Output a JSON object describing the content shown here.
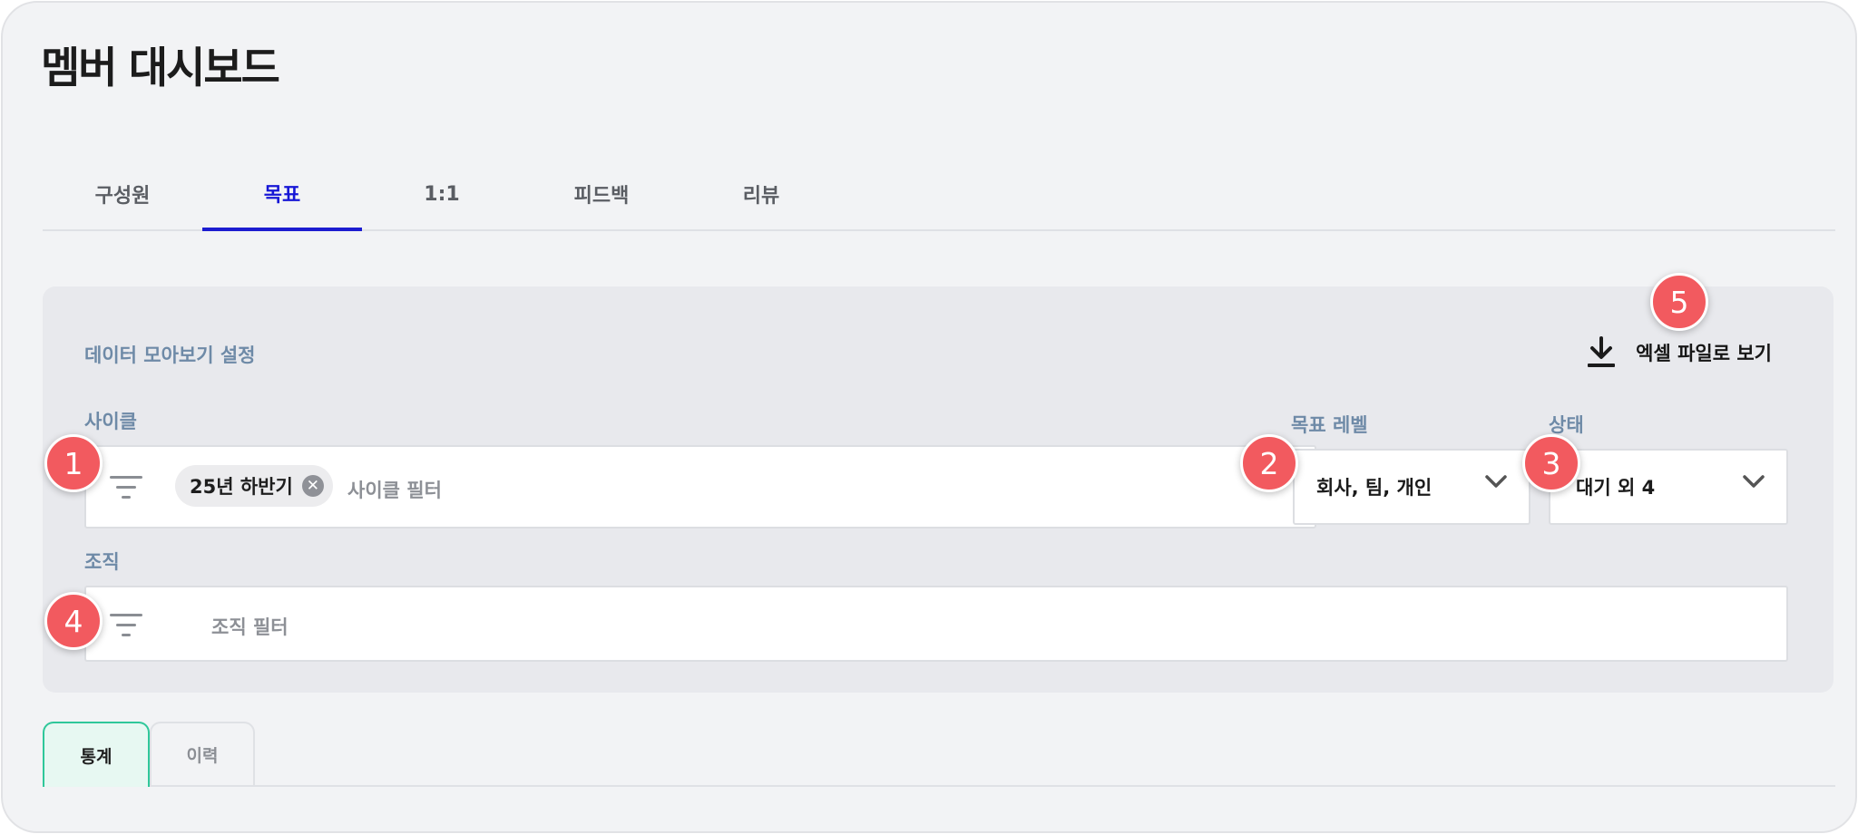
{
  "page": {
    "title": "멤버 대시보드"
  },
  "tabs": [
    {
      "label": "구성원",
      "active": false
    },
    {
      "label": "목표",
      "active": true
    },
    {
      "label": "1:1",
      "active": false
    },
    {
      "label": "피드백",
      "active": false
    },
    {
      "label": "리뷰",
      "active": false
    }
  ],
  "settings": {
    "title": "데이터 모아보기 설정",
    "export_label": "엑셀 파일로 보기",
    "export_icon": "download-icon",
    "cycle": {
      "label": "사이클",
      "chip": "25년 하반기",
      "placeholder": "사이클 필터"
    },
    "goal_level": {
      "label": "목표 레벨",
      "value": "회사, 팀, 개인"
    },
    "status": {
      "label": "상태",
      "value": "대기 외 4"
    },
    "org": {
      "label": "조직",
      "placeholder": "조직 필터"
    }
  },
  "markers": [
    "1",
    "2",
    "3",
    "4",
    "5"
  ],
  "sub_tabs": [
    {
      "label": "통계",
      "active": true
    },
    {
      "label": "이력",
      "active": false
    }
  ],
  "colors": {
    "active_tab": "#1616d6",
    "marker": "#f25a5f",
    "label": "#6e8aa7",
    "active_subtab_bg": "#e7f8f2",
    "active_subtab_border": "#2fc79a"
  }
}
